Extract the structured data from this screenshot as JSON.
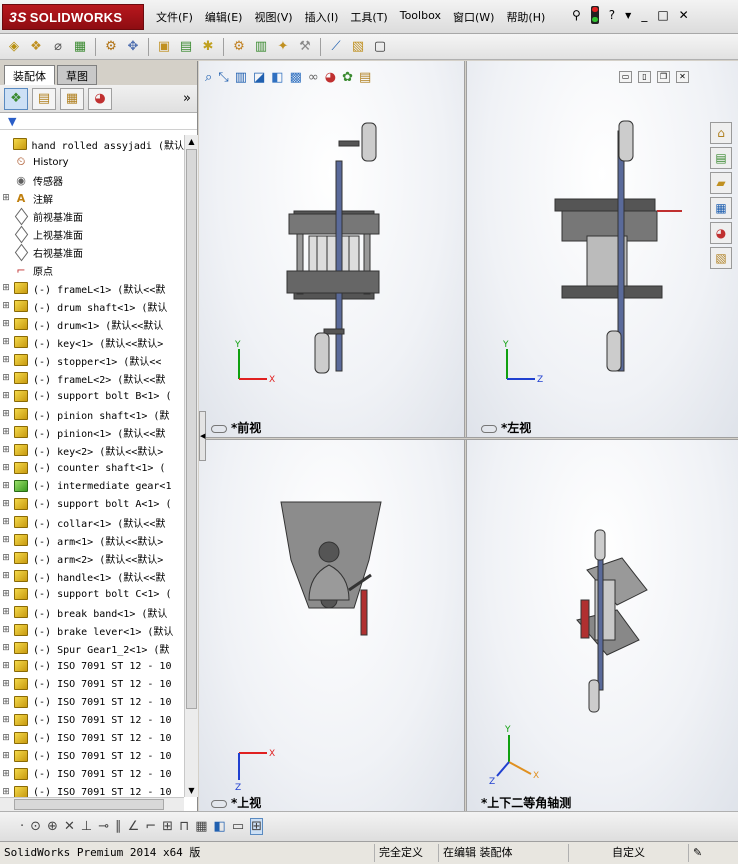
{
  "app": {
    "logo_text": "SOLIDWORKS",
    "logo_prefix": "3S",
    "menu": [
      "文件(F)",
      "编辑(E)",
      "视图(V)",
      "插入(I)",
      "工具(T)",
      "Toolbox",
      "窗口(W)",
      "帮助(H)"
    ],
    "help_glyph": "?",
    "window_controls": [
      "_",
      "□",
      "✕"
    ]
  },
  "panel": {
    "tabs": [
      "装配体",
      "草图"
    ],
    "expand_glyph": "»"
  },
  "tree": {
    "root": "hand rolled assyjadi  (默认",
    "items": [
      {
        "label": "History",
        "icon": "history-icon",
        "expandable": false
      },
      {
        "label": "传感器",
        "icon": "sensor-icon",
        "expandable": false
      },
      {
        "label": "注解",
        "icon": "annotation-icon",
        "expandable": true
      },
      {
        "label": "前视基准面",
        "icon": "plane-icon",
        "expandable": false
      },
      {
        "label": "上视基准面",
        "icon": "plane-icon",
        "expandable": false
      },
      {
        "label": "右视基准面",
        "icon": "plane-icon",
        "expandable": false
      },
      {
        "label": "原点",
        "icon": "origin-icon",
        "expandable": false
      },
      {
        "label": "(-) frameL<1> (默认<<默",
        "icon": "part-icon",
        "expandable": true
      },
      {
        "label": "(-) drum shaft<1> (默认",
        "icon": "part-icon",
        "expandable": true
      },
      {
        "label": "(-) drum<1> (默认<<默认",
        "icon": "part-icon",
        "expandable": true
      },
      {
        "label": "(-) key<1> (默认<<默认>",
        "icon": "part-icon",
        "expandable": true
      },
      {
        "label": "(-) stopper<1> (默认<<",
        "icon": "part-icon",
        "expandable": true
      },
      {
        "label": "(-) frameL<2> (默认<<默",
        "icon": "part-icon",
        "expandable": true
      },
      {
        "label": "(-) support bolt B<1> (",
        "icon": "part-icon",
        "expandable": true
      },
      {
        "label": "(-) pinion shaft<1> (默",
        "icon": "part-icon",
        "expandable": true
      },
      {
        "label": "(-) pinion<1> (默认<<默",
        "icon": "part-icon",
        "expandable": true
      },
      {
        "label": "(-) key<2> (默认<<默认>",
        "icon": "part-icon",
        "expandable": true
      },
      {
        "label": "(-) counter shaft<1> (",
        "icon": "part-icon",
        "expandable": true
      },
      {
        "label": "(-) intermediate gear<1",
        "icon": "part-icon-green",
        "expandable": true
      },
      {
        "label": "(-) support bolt A<1> (",
        "icon": "part-icon",
        "expandable": true
      },
      {
        "label": "(-) collar<1> (默认<<默",
        "icon": "part-icon",
        "expandable": true
      },
      {
        "label": "(-) arm<1> (默认<<默认>",
        "icon": "part-icon",
        "expandable": true
      },
      {
        "label": "(-) arm<2> (默认<<默认>",
        "icon": "part-icon",
        "expandable": true
      },
      {
        "label": "(-) handle<1> (默认<<默",
        "icon": "part-icon",
        "expandable": true
      },
      {
        "label": "(-) support bolt C<1> (",
        "icon": "part-icon",
        "expandable": true
      },
      {
        "label": "(-) break band<1> (默认",
        "icon": "part-icon",
        "expandable": true
      },
      {
        "label": "(-) brake lever<1> (默认",
        "icon": "part-icon",
        "expandable": true
      },
      {
        "label": "(-) Spur Gear1_2<1> (默",
        "icon": "part-icon",
        "expandable": true
      },
      {
        "label": "(-) ISO 7091 ST 12 - 10",
        "icon": "part-icon",
        "expandable": true
      },
      {
        "label": "(-) ISO 7091 ST 12 - 10",
        "icon": "part-icon",
        "expandable": true
      },
      {
        "label": "(-) ISO 7091 ST 12 - 10",
        "icon": "part-icon",
        "expandable": true
      },
      {
        "label": "(-) ISO 7091 ST 12 - 10",
        "icon": "part-icon",
        "expandable": true
      },
      {
        "label": "(-) ISO 7091 ST 12 - 10",
        "icon": "part-icon",
        "expandable": true
      },
      {
        "label": "(-) ISO 7091 ST 12 - 10",
        "icon": "part-icon",
        "expandable": true
      },
      {
        "label": "(-) ISO 7091 ST 12 - 10",
        "icon": "part-icon",
        "expandable": true
      },
      {
        "label": "(-) ISO 7091 ST 12 - 10",
        "icon": "part-icon",
        "expandable": true
      }
    ]
  },
  "views": [
    {
      "label": "*前视",
      "axes": [
        "Y",
        "X"
      ]
    },
    {
      "label": "*左视",
      "axes": [
        "Y",
        "Z"
      ]
    },
    {
      "label": "*上视",
      "axes": [
        "X",
        "Z"
      ]
    },
    {
      "label": "*上下二等角轴测",
      "axes": [
        "Y",
        "X",
        "Z"
      ]
    }
  ],
  "status": {
    "product": "SolidWorks Premium 2014 x64 版",
    "definition": "完全定义",
    "editing": "在编辑 装配体",
    "units": "自定义",
    "edit_glyph": "✎"
  },
  "colors": {
    "brand": "#b8171d",
    "axis_x": "#e02020",
    "axis_y": "#10a010",
    "axis_z": "#2040d0"
  }
}
